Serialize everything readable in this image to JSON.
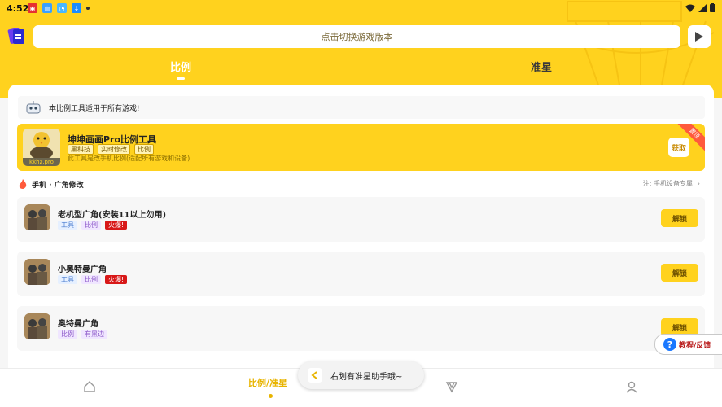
{
  "status": {
    "time": "4:52"
  },
  "topbar": {
    "version_label": "点击切换游戏版本"
  },
  "tabs": [
    {
      "label": "比例"
    },
    {
      "label": "准星"
    }
  ],
  "info": {
    "text": "本比例工具适用于所有游戏!"
  },
  "promo": {
    "title": "坤坤画画Pro比例工具",
    "tags": [
      "黑科技",
      "实时修改",
      "比例"
    ],
    "desc": "此工具是改手机比例(适配所有游戏和设备)",
    "button": "获取",
    "ribbon": "置顶",
    "thumb_label": "kkhz.pro"
  },
  "section": {
    "title": "手机 · 广角修改",
    "note": "注: 手机设备专属!"
  },
  "items": [
    {
      "title": "老机型广角(安装11以上勿用)",
      "tags": [
        {
          "text": "工具",
          "kind": "tool"
        },
        {
          "text": "比例",
          "kind": "ratio"
        },
        {
          "text": "火爆!",
          "kind": "hot"
        }
      ],
      "button": "解锁"
    },
    {
      "title": "小奥特曼广角",
      "tags": [
        {
          "text": "工具",
          "kind": "tool"
        },
        {
          "text": "比例",
          "kind": "ratio"
        },
        {
          "text": "火爆!",
          "kind": "hot"
        }
      ],
      "button": "解锁"
    },
    {
      "title": "奥特曼广角",
      "tags": [
        {
          "text": "比例",
          "kind": "ratio"
        },
        {
          "text": "有黑边",
          "kind": "black"
        }
      ],
      "button": "解锁"
    }
  ],
  "help": {
    "label": "教程/反馈"
  },
  "nav": {
    "active_label": "比例/准星"
  },
  "toast": {
    "text": "右划有准星助手哦~"
  },
  "colors": {
    "brand": "#ffd21e",
    "accent": "#e8b400",
    "hot": "#d81818"
  }
}
